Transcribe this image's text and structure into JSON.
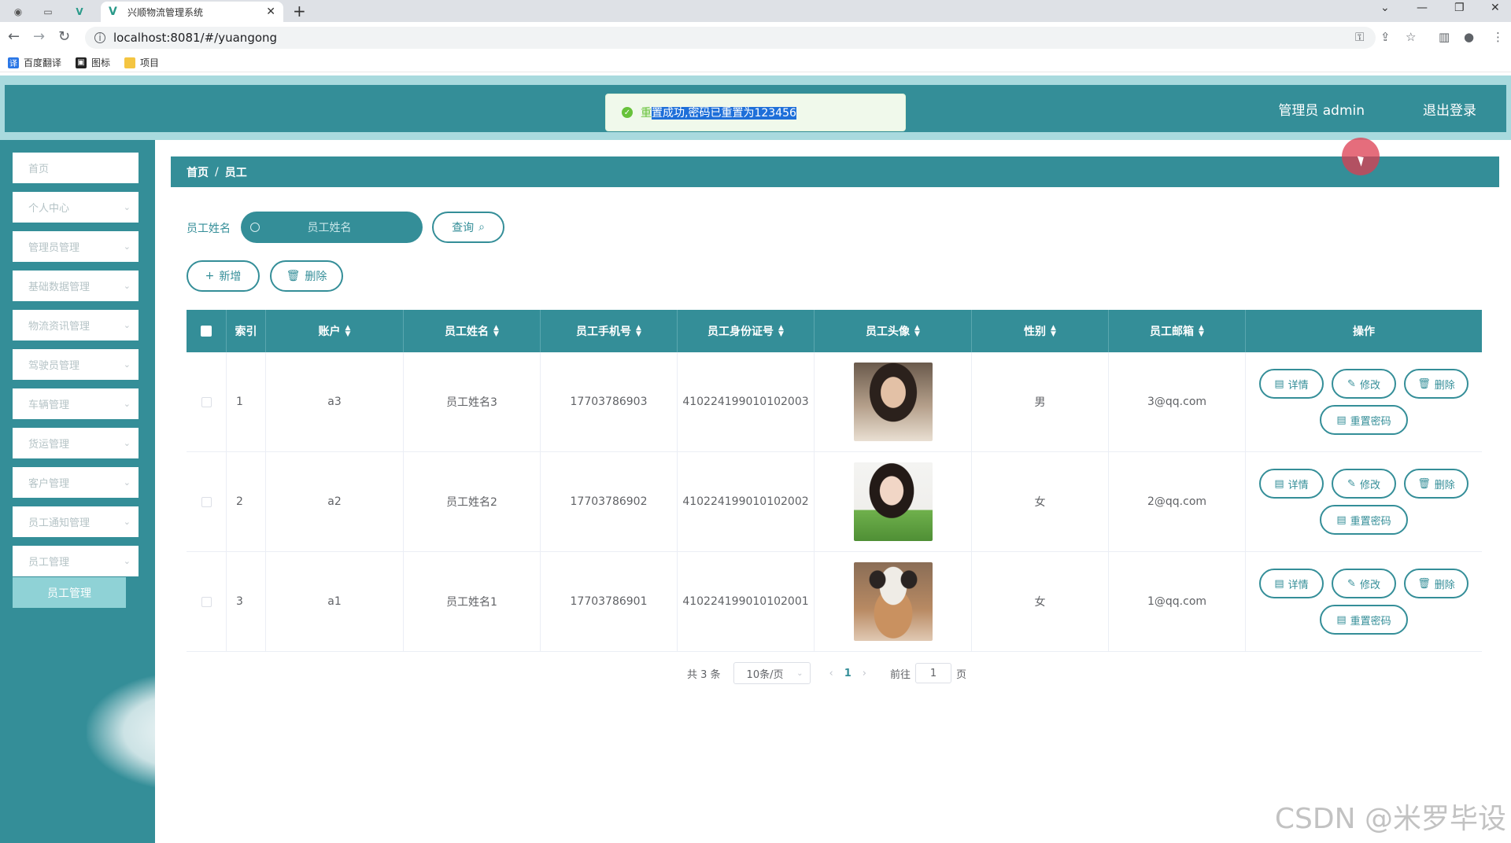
{
  "browser": {
    "tab_title": "兴顺物流管理系统",
    "url": "localhost:8081/#/yuangong",
    "bookmarks": [
      {
        "label": "百度翻译",
        "color": "#2b77e6",
        "glyph": "译"
      },
      {
        "label": "图标",
        "color": "#222222",
        "glyph": "▣"
      },
      {
        "label": "项目",
        "color": "#f4c542",
        "glyph": ""
      }
    ]
  },
  "header": {
    "user": "管理员 admin",
    "logout": "退出登录"
  },
  "toast": {
    "prefix": "重",
    "selected": "置成功,密码已重置为123456"
  },
  "sidebar": {
    "items": [
      {
        "label": "首页",
        "has_children": false
      },
      {
        "label": "个人中心",
        "has_children": true
      },
      {
        "label": "管理员管理",
        "has_children": true
      },
      {
        "label": "基础数据管理",
        "has_children": true
      },
      {
        "label": "物流资讯管理",
        "has_children": true
      },
      {
        "label": "驾驶员管理",
        "has_children": true
      },
      {
        "label": "车辆管理",
        "has_children": true
      },
      {
        "label": "货运管理",
        "has_children": true
      },
      {
        "label": "客户管理",
        "has_children": true
      },
      {
        "label": "员工通知管理",
        "has_children": true
      },
      {
        "label": "员工管理",
        "has_children": true
      }
    ],
    "active_sub": "员工管理"
  },
  "breadcrumb": {
    "home": "首页",
    "sep": "/",
    "current": "员工"
  },
  "search": {
    "label": "员工姓名",
    "placeholder": "员工姓名",
    "query_button": "查询"
  },
  "toolbar": {
    "add": "新增",
    "delete": "删除"
  },
  "table": {
    "columns": [
      "索引",
      "账户",
      "员工姓名",
      "员工手机号",
      "员工身份证号",
      "员工头像",
      "性别",
      "员工邮箱",
      "操作"
    ],
    "rows": [
      {
        "index": "1",
        "account": "a3",
        "name": "员工姓名3",
        "phone": "17703786903",
        "idcard": "410224199010102003",
        "gender": "男",
        "email": "3@qq.com"
      },
      {
        "index": "2",
        "account": "a2",
        "name": "员工姓名2",
        "phone": "17703786902",
        "idcard": "410224199010102002",
        "gender": "女",
        "email": "2@qq.com"
      },
      {
        "index": "3",
        "account": "a1",
        "name": "员工姓名1",
        "phone": "17703786901",
        "idcard": "410224199010102001",
        "gender": "女",
        "email": "1@qq.com"
      }
    ],
    "actions": {
      "detail": "详情",
      "edit": "修改",
      "delete": "删除",
      "reset": "重置密码"
    }
  },
  "pagination": {
    "total": "共 3 条",
    "page_size": "10条/页",
    "current": "1",
    "goto_label": "前往",
    "goto_value": "1",
    "goto_suffix": "页"
  },
  "watermark": "CSDN @米罗毕设",
  "colors": {
    "accent": "#348e98",
    "success": "#67c23a"
  }
}
